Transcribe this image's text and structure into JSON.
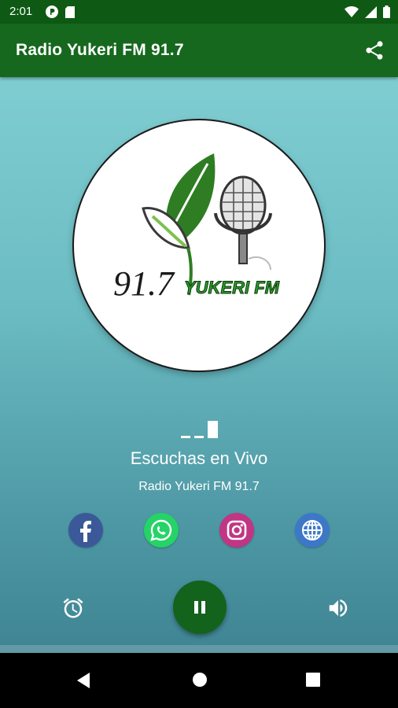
{
  "status_bar": {
    "time": "2:01",
    "left_icons": [
      "p-icon",
      "sd-card-icon"
    ],
    "right_icons": [
      "wifi-icon",
      "signal-icon",
      "battery-icon"
    ]
  },
  "app_bar": {
    "title": "Radio Yukeri FM 91.7",
    "share_icon": "share-icon"
  },
  "logo": {
    "frequency": "91.7",
    "name": "YUKERI FM"
  },
  "player": {
    "listen_title": "Escuchas en Vivo",
    "station_name": "Radio Yukeri FM 91.7",
    "state": "playing"
  },
  "social": [
    {
      "name": "facebook",
      "icon": "facebook-icon",
      "color": "#3b5998"
    },
    {
      "name": "whatsapp",
      "icon": "whatsapp-icon",
      "color": "#25d366"
    },
    {
      "name": "instagram",
      "icon": "instagram-icon",
      "color": "#c13584"
    },
    {
      "name": "website",
      "icon": "globe-icon",
      "color": "#3d78c8"
    }
  ],
  "controls": {
    "left": "alarm-icon",
    "center": "pause-icon",
    "right": "volume-icon"
  },
  "nav_bar": [
    "back-icon",
    "home-icon",
    "recents-icon"
  ],
  "colors": {
    "status_bar": "#0e5a14",
    "app_bar": "#15681d",
    "accent": "#13631c",
    "background_top": "#7fcdd1",
    "background_bottom": "#3f8493"
  }
}
